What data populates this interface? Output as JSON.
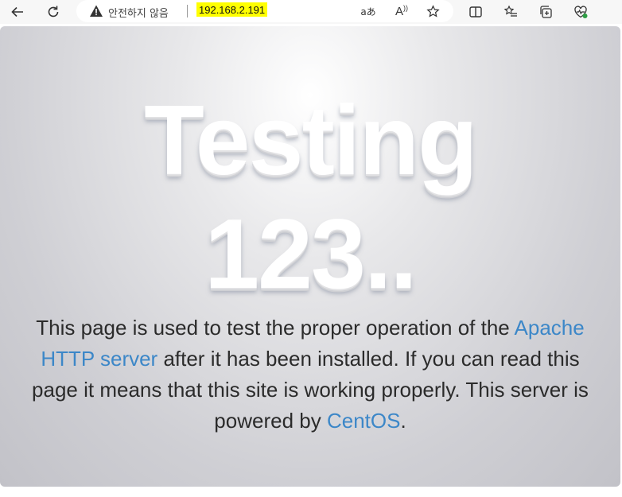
{
  "browser": {
    "security_label": "안전하지 않음",
    "url": "192.168.2.191",
    "icons": {
      "back": "back-arrow-icon",
      "refresh": "refresh-icon",
      "warning": "warning-icon",
      "translate": "translate-icon",
      "read_aloud": "read-aloud-icon",
      "favorite": "star-icon",
      "split_screen": "split-screen-icon",
      "favorites": "favorites-list-icon",
      "collections": "collections-icon",
      "health": "browser-essentials-icon"
    },
    "translate_text": "aあ",
    "read_aloud_text": "A"
  },
  "page": {
    "headline_line1": "Testing",
    "headline_line2": "123..",
    "desc_part1": "This page is used to test the proper operation of the ",
    "apache_link": "Apache HTTP server",
    "desc_part2": " after it has been installed. If you can read this page it means that this site is working properly. This server is powered by ",
    "centos_link": "CentOS",
    "desc_part3": "."
  },
  "colors": {
    "link": "#3c87c8",
    "url_highlight": "#ffff00",
    "text": "#2b2b2b"
  }
}
